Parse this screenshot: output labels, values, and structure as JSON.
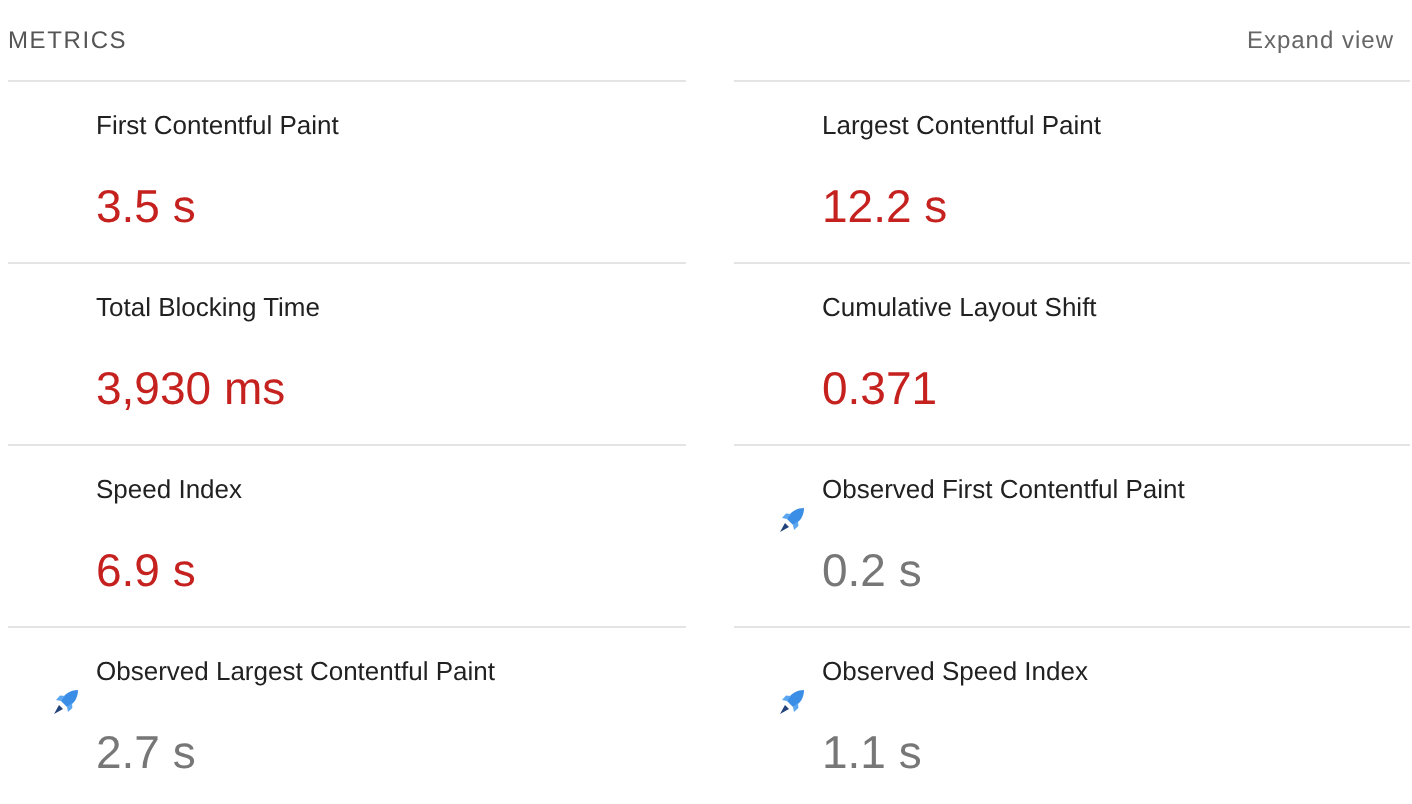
{
  "header": {
    "title": "METRICS",
    "expand_button": "Expand view"
  },
  "metrics": [
    {
      "kind": "lab",
      "label": "First Contentful Paint",
      "value": "3.5 s"
    },
    {
      "kind": "lab",
      "label": "Largest Contentful Paint",
      "value": "12.2 s"
    },
    {
      "kind": "lab",
      "label": "Total Blocking Time",
      "value": "3,930 ms"
    },
    {
      "kind": "lab",
      "label": "Cumulative Layout Shift",
      "value": "0.371"
    },
    {
      "kind": "lab",
      "label": "Speed Index",
      "value": "6.9 s"
    },
    {
      "kind": "observed",
      "label": "Observed First Contentful Paint",
      "value": "0.2 s"
    },
    {
      "kind": "observed",
      "label": "Observed Largest Contentful Paint",
      "value": "2.7 s"
    },
    {
      "kind": "observed",
      "label": "Observed Speed Index",
      "value": "1.1 s"
    }
  ]
}
